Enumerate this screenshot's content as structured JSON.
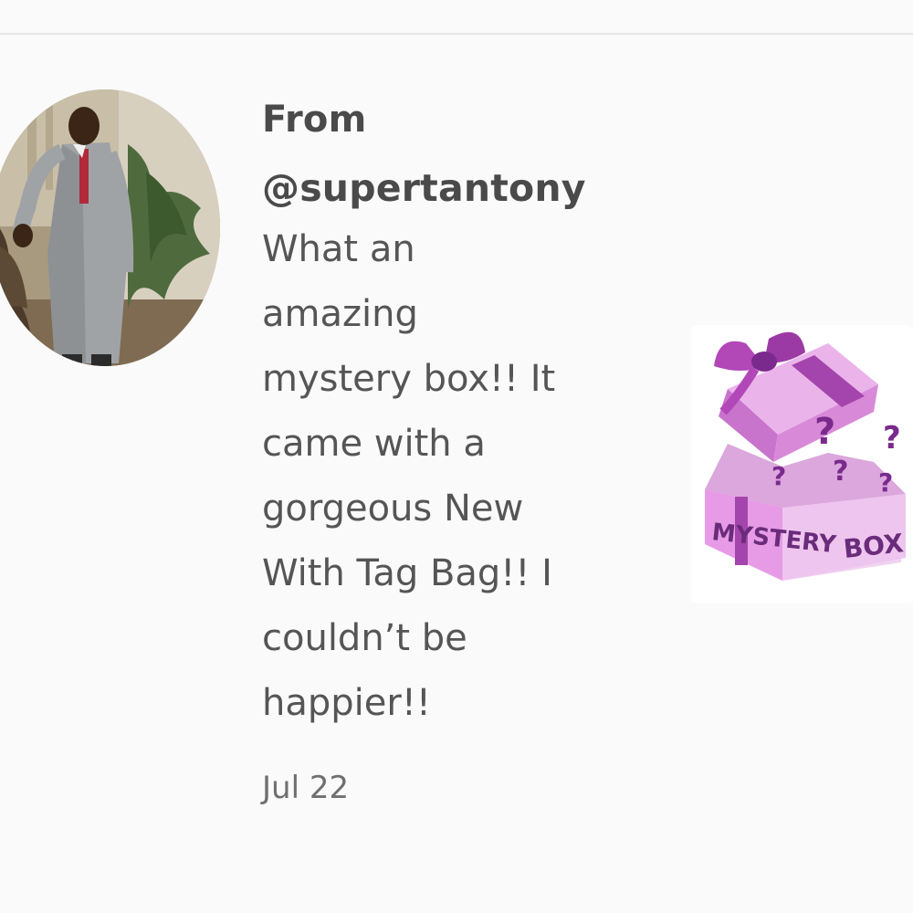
{
  "comment": {
    "from_label": "From",
    "username": "@supertantony",
    "message_lines": [
      "What an",
      "amazing",
      "mystery box!! It",
      "came with a",
      "gorgeous New",
      "With Tag Bag!! I",
      "couldn’t be",
      "happier!!"
    ],
    "date": "Jul 22"
  },
  "attachment": {
    "image_text": "MYSTERY BOX",
    "word1": "MYSTERY",
    "word2": "BOX"
  },
  "colors": {
    "background": "#fafafa",
    "text": "#505050",
    "box_pink": "#e79be6",
    "box_purple": "#7a2a8c"
  }
}
